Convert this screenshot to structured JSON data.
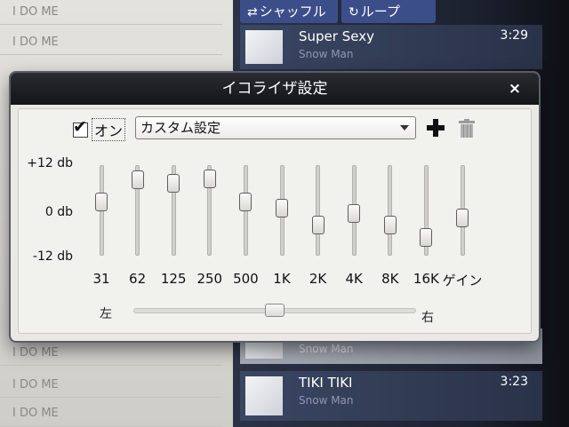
{
  "background": {
    "shuffle_label": "シャッフル",
    "loop_label": "ループ",
    "list_rows": [
      "I DO ME",
      "I DO ME",
      "I DO ME",
      "I DO ME",
      "I DO ME"
    ],
    "tracks": [
      {
        "title": "Super Sexy",
        "artist": "Snow Man",
        "duration": "3:29"
      },
      {
        "title": "",
        "artist": "Snow Man",
        "duration": ""
      },
      {
        "title": "TIKI TIKI",
        "artist": "Snow Man",
        "duration": "3:23"
      }
    ]
  },
  "dialog": {
    "title": "イコライザ設定",
    "close_label": "×",
    "enabled": true,
    "enabled_check": "✔",
    "enabled_label": "オン",
    "preset": "カスタム設定",
    "db_scale": {
      "max": "+12 db",
      "mid": "0 db",
      "min": "-12 db"
    },
    "bands": [
      {
        "label": "31",
        "level": 0.62
      },
      {
        "label": "62",
        "level": 0.92
      },
      {
        "label": "125",
        "level": 0.88
      },
      {
        "label": "250",
        "level": 0.94
      },
      {
        "label": "500",
        "level": 0.62
      },
      {
        "label": "1K",
        "level": 0.53
      },
      {
        "label": "2K",
        "level": 0.3
      },
      {
        "label": "4K",
        "level": 0.46
      },
      {
        "label": "8K",
        "level": 0.3
      },
      {
        "label": "16K",
        "level": 0.12
      },
      {
        "label": "ゲイン",
        "level": 0.4
      }
    ],
    "balance": {
      "left_label": "左",
      "right_label": "右",
      "value": 0.5
    }
  }
}
